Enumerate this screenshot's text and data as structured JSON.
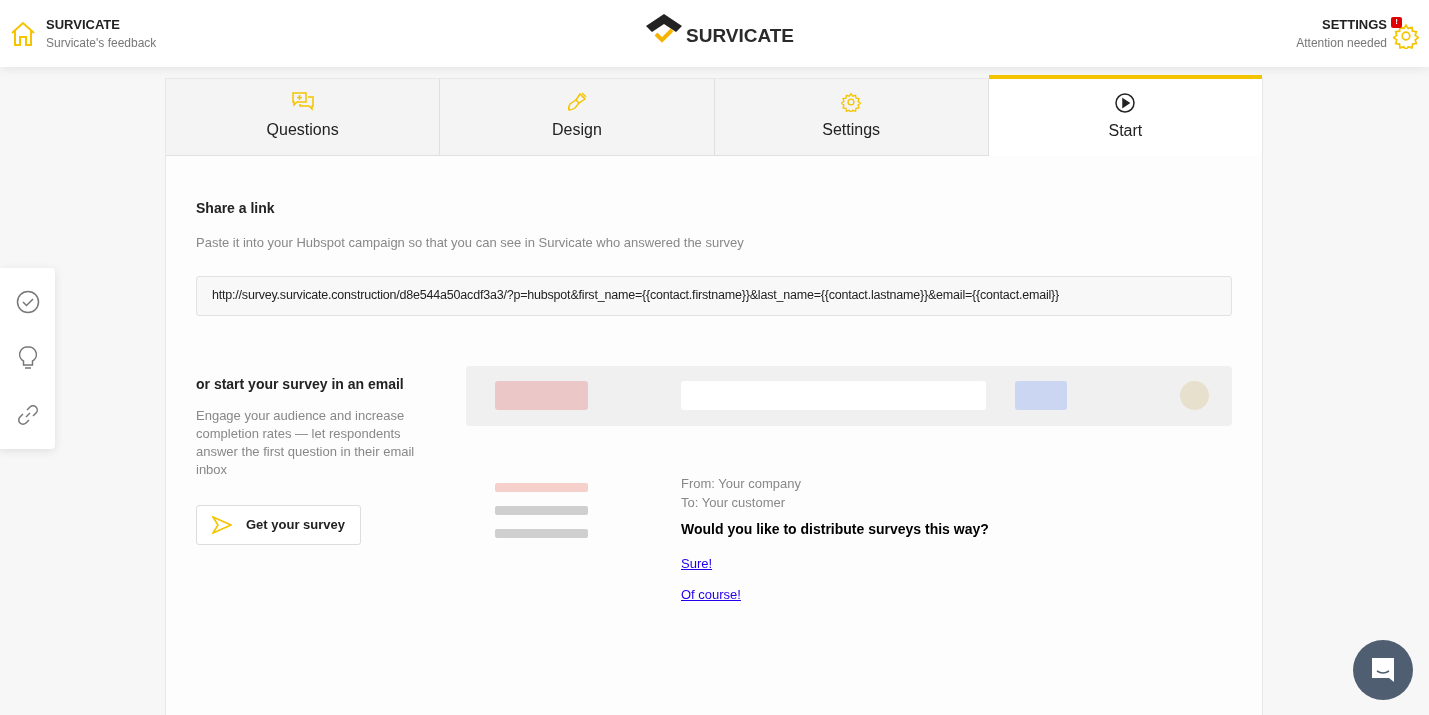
{
  "header": {
    "home": {
      "title": "SURVICATE",
      "subtitle": "Survicate's feedback"
    },
    "logo": "SURVICATE",
    "settings": {
      "title": "SETTINGS",
      "subtitle": "Attention needed",
      "badge": "!"
    }
  },
  "tabs": [
    {
      "kind": "questions",
      "label": "Questions",
      "selected": false
    },
    {
      "kind": "design",
      "label": "Design",
      "selected": false
    },
    {
      "kind": "settings",
      "label": "Settings",
      "selected": false
    },
    {
      "kind": "start",
      "label": "Start",
      "selected": true
    }
  ],
  "side_toolbar": [
    {
      "kind": "check"
    },
    {
      "kind": "bulb"
    },
    {
      "kind": "link"
    }
  ],
  "share": {
    "title": "Share a link",
    "description": "Paste it into your Hubspot campaign so that you can see in Survicate who answered the survey",
    "url": "http://survey.survicate.construction/d8e544a50acdf3a3/?p=hubspot&first_name={{contact.firstname}}&last_name={{contact.lastname}}&email={{contact.email}}"
  },
  "email": {
    "title": "or start your survey in an email",
    "description": "Engage your audience and increase completion rates — let respondents answer the first question in their email inbox",
    "button": "Get your survey",
    "preview": {
      "from": "From: Your company",
      "to": "To: Your customer",
      "question": "Would you like to distribute surveys this way?",
      "answers": [
        "Sure!",
        "Of course!"
      ]
    }
  }
}
